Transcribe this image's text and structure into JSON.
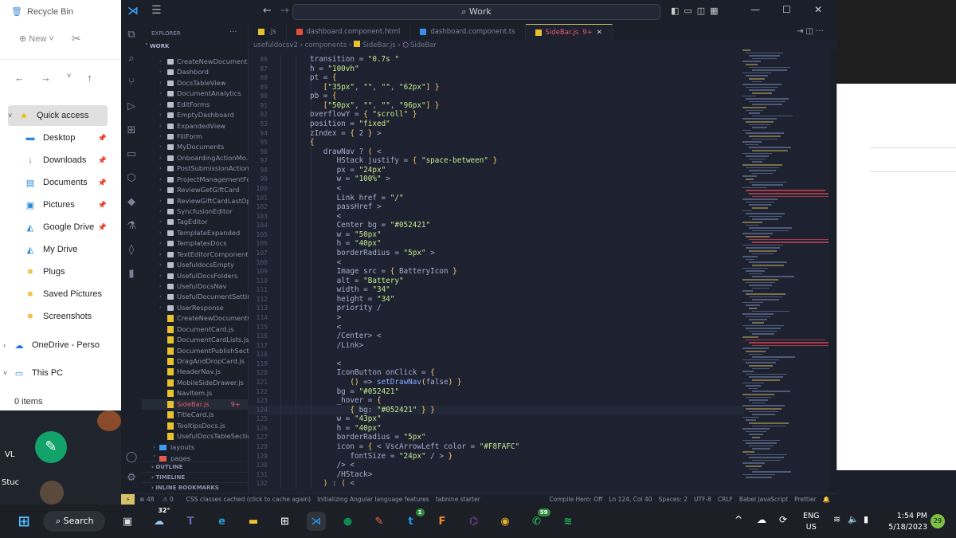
{
  "background": {
    "desktop_labels": [
      "VL",
      "Stuc"
    ]
  },
  "file_explorer": {
    "title": "Recycle Bin",
    "new_label": "New",
    "nav_items": [
      {
        "label": "Quick access",
        "icon": "star-icon",
        "selected": true
      },
      {
        "label": "Desktop",
        "icon": "desktop-icon",
        "pinned": true
      },
      {
        "label": "Downloads",
        "icon": "download-icon",
        "pinned": true
      },
      {
        "label": "Documents",
        "icon": "documents-icon",
        "pinned": true
      },
      {
        "label": "Pictures",
        "icon": "pictures-icon",
        "pinned": true
      },
      {
        "label": "Google Drive",
        "icon": "drive-icon",
        "pinned": true
      },
      {
        "label": "My Drive",
        "icon": "drive-icon"
      },
      {
        "label": "Plugs",
        "icon": "folder-icon"
      },
      {
        "label": "Saved Pictures",
        "icon": "folder-icon"
      },
      {
        "label": "Screenshots",
        "icon": "folder-icon"
      },
      {
        "label": "OneDrive - Perso",
        "icon": "onedrive-icon"
      },
      {
        "label": "This PC",
        "icon": "pc-icon"
      }
    ],
    "status": "0 items"
  },
  "vscode": {
    "search": "Work",
    "explorer_title": "EXPLORER",
    "workspace": "WORK",
    "tree": [
      {
        "name": "CreateNewDocument",
        "type": "folder"
      },
      {
        "name": "Dashbord",
        "type": "folder"
      },
      {
        "name": "DocsTableView",
        "type": "folder"
      },
      {
        "name": "DocumentAnalytics",
        "type": "folder"
      },
      {
        "name": "EditForms",
        "type": "folder"
      },
      {
        "name": "EmptyDashboard",
        "type": "folder"
      },
      {
        "name": "ExpandedView",
        "type": "folder"
      },
      {
        "name": "FillForm",
        "type": "folder"
      },
      {
        "name": "MyDocuments",
        "type": "folder"
      },
      {
        "name": "OnboardingActionMo...",
        "type": "folder"
      },
      {
        "name": "PostSubmissionAction",
        "type": "folder"
      },
      {
        "name": "ProjectManagementFo...",
        "type": "folder"
      },
      {
        "name": "ReviewGetGiftCard",
        "type": "folder"
      },
      {
        "name": "ReviewGiftCardLastOp...",
        "type": "folder"
      },
      {
        "name": "SyncfusionEditor",
        "type": "folder"
      },
      {
        "name": "TagEditor",
        "type": "folder"
      },
      {
        "name": "TemplateExpanded",
        "type": "folder"
      },
      {
        "name": "TemplatesDocs",
        "type": "folder"
      },
      {
        "name": "TextEditorComponent",
        "type": "folder"
      },
      {
        "name": "UsefuldocsEmpty",
        "type": "folder"
      },
      {
        "name": "UsefulDocsFolders",
        "type": "folder"
      },
      {
        "name": "UsefulDocsNav",
        "type": "folder"
      },
      {
        "name": "UsefulDocumentSetting",
        "type": "folder"
      },
      {
        "name": "UserResponse",
        "type": "folder"
      },
      {
        "name": "CreateNewDocumentC...",
        "type": "js"
      },
      {
        "name": "DocumentCard.js",
        "type": "js"
      },
      {
        "name": "DocumentCardLists.js",
        "type": "js"
      },
      {
        "name": "DocumentPublishSecti...",
        "type": "js"
      },
      {
        "name": "DragAndDropCard.js",
        "type": "js"
      },
      {
        "name": "HeaderNav.js",
        "type": "js"
      },
      {
        "name": "MobileSideDrawer.js",
        "type": "js"
      },
      {
        "name": "NavItem.js",
        "type": "js"
      },
      {
        "name": "SideBar.js",
        "type": "js",
        "selected": true,
        "badge": "9+"
      },
      {
        "name": "TitleCard.js",
        "type": "js"
      },
      {
        "name": "TooltipsDocs.js",
        "type": "js"
      },
      {
        "name": "UsefulDocsTableSectio...",
        "type": "js"
      }
    ],
    "folders_after": [
      "layouts",
      "pages"
    ],
    "sections": [
      "OUTLINE",
      "TIMELINE",
      "INLINE BOOKMARKS"
    ],
    "tabs": [
      {
        "label": ".js",
        "color": "#e8c22c"
      },
      {
        "label": "dashboard.component.html",
        "color": "#e44d3a"
      },
      {
        "label": "dashboard.component.ts",
        "color": "#3b8eea"
      },
      {
        "label": "SideBar.js",
        "color": "#e8c22c",
        "active": true,
        "badge": "9+"
      }
    ],
    "breadcrumb": [
      "usefuldocsv2",
      "components",
      "SideBar.js",
      "SideBar"
    ],
    "first_line": 86,
    "current_line": 124,
    "code": [
      "transition = \"0.7s \"",
      "h = \"100vh\"",
      "pt = {",
      "   [\"35px\", \"\", \"\", \"62px\"] }",
      "pb = {",
      "   [\"50px\", \"\", \"\", \"96px\"] }",
      "overflowY = { \"scroll\" }",
      "position = \"fixed\"",
      "zIndex = { 2 } >",
      "{",
      "   drawNav ? ( <",
      "      HStack justify = { \"space-between\" }",
      "      px = \"24px\"",
      "      w = \"100%\" >",
      "      <",
      "      Link href = \"/\"",
      "      passHref >",
      "      <",
      "      Center bg = \"#052421\"",
      "      w = \"50px\"",
      "      h = \"40px\"",
      "      borderRadius = \"5px\" >",
      "      <",
      "      Image src = { BatteryIcon }",
      "      alt = \"Battery\"",
      "      width = \"34\"",
      "      height = \"34\"",
      "      priority /",
      "      >",
      "      <",
      "      /Center> <",
      "      /Link>",
      "",
      "      <",
      "      IconButton onClick = {",
      "         () => setDrawNav(false) }",
      "      bg = \"#052421\"",
      "      _hover = {",
      "         { bg: \"#052421\" } }",
      "      w = \"43px\"",
      "      h = \"40px\"",
      "      borderRadius = \"5px\"",
      "      icon = { < VscArrowLeft color = \"#F8FAFC\"",
      "         fontSize = \"24px\" / > }",
      "      /> <",
      "      /HStack>",
      "   ) : ( <"
    ],
    "status": {
      "errors": "48",
      "warnings": "0",
      "items_left": [
        "CSS classes cached (click to cache again)",
        "Initializing Angular language features",
        "tabnine starter"
      ],
      "items_right": [
        "Compile Hero: Off",
        "Ln 124, Col 40",
        "Spaces: 2",
        "UTF-8",
        "CRLF",
        "Babel JavaScript",
        "Prettier"
      ]
    }
  },
  "taskbar": {
    "search_label": "Search",
    "weather": "32°",
    "apps": [
      {
        "name": "task-view",
        "color": "#ddd"
      },
      {
        "name": "weather",
        "color": "#9ec9f0"
      },
      {
        "name": "teams",
        "color": "#6264a7"
      },
      {
        "name": "edge",
        "color": "#1ea1d1"
      },
      {
        "name": "file-explorer",
        "color": "#f4c430"
      },
      {
        "name": "store",
        "color": "#e8e8e8"
      },
      {
        "name": "vscode",
        "color": "#2a8ddb",
        "active": true
      },
      {
        "name": "app-green",
        "color": "#0e8a4f"
      },
      {
        "name": "postman",
        "color": "#f26b3a"
      },
      {
        "name": "twitter",
        "color": "#1d9bf0",
        "badge": "1"
      },
      {
        "name": "fl-studio",
        "color": "#f08a24"
      },
      {
        "name": "github",
        "color": "#8e44ad"
      },
      {
        "name": "chrome",
        "color": "#e3b12b"
      },
      {
        "name": "whatsapp",
        "color": "#25d366",
        "badge": "59"
      },
      {
        "name": "spotify",
        "color": "#1db954"
      }
    ],
    "lang": "ENG",
    "region": "US",
    "time": "1:54 PM",
    "date": "5/18/2023",
    "notification_count": "29"
  }
}
